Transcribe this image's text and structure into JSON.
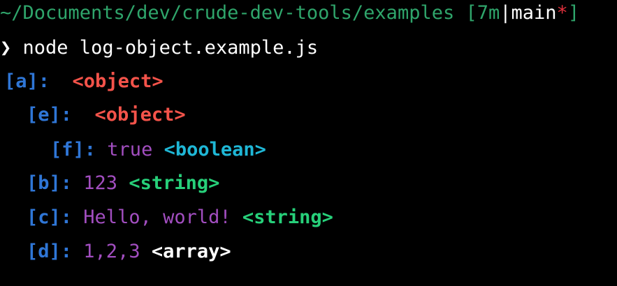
{
  "prompt_line": {
    "path": "~/Documents/dev/crude-dev-tools/examples",
    "git_open": " [",
    "git_time": "7m",
    "git_sep": "|",
    "git_branch": "main",
    "git_dirty": "*",
    "git_close": "]"
  },
  "command_line": {
    "prompt_symbol": "❯",
    "command": "node log-object.example.js"
  },
  "output": [
    {
      "key": "[a]:",
      "value": "",
      "type": "<object>"
    },
    {
      "key": "[e]:",
      "value": "",
      "type": "<object>"
    },
    {
      "key": "[f]:",
      "value": "true",
      "type": "<boolean>"
    },
    {
      "key": "[b]:",
      "value": "123",
      "type": "<string>"
    },
    {
      "key": "[c]:",
      "value": "Hello, world!",
      "type": "<string>"
    },
    {
      "key": "[d]:",
      "value": "1,2,3",
      "type": "<array>"
    }
  ],
  "colors": {
    "background": "#000000",
    "path": "#2fa56b",
    "key": "#2f76d6",
    "value": "#a24ec0",
    "object_tag": "#f4534a",
    "boolean_tag": "#1fb7d6",
    "string_tag": "#27d07a",
    "array_tag": "#ffffff",
    "dirty": "#e0303c"
  }
}
